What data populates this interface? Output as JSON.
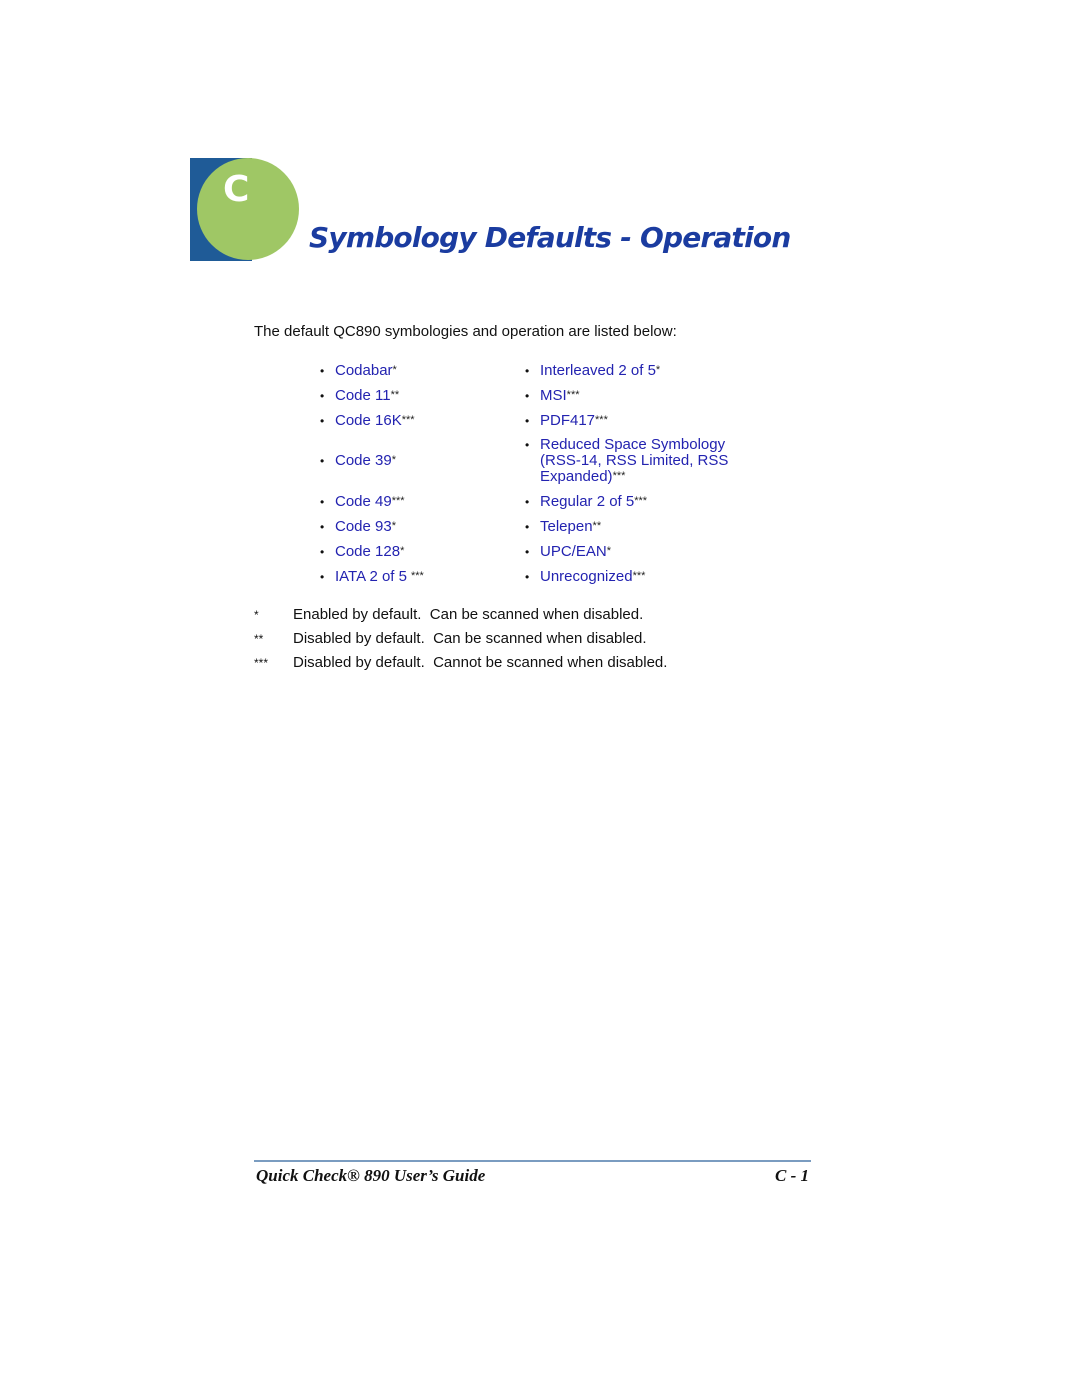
{
  "chapter": {
    "letter": "C",
    "title": "Symbology Defaults - Operation",
    "badge_colors": {
      "square": "#1f5b97",
      "circle": "#9fc765"
    }
  },
  "intro": "The default QC890 symbologies and operation are listed below:",
  "symbologies": {
    "bullet": "•",
    "rows": [
      {
        "left": {
          "label": "Codabar",
          "stars": "*"
        },
        "right": {
          "label": "Interleaved 2 of 5",
          "stars": "*"
        }
      },
      {
        "left": {
          "label": "Code 11",
          "stars": "**"
        },
        "right": {
          "label": "MSI",
          "stars": "***"
        }
      },
      {
        "left": {
          "label": "Code 16K",
          "stars": "***"
        },
        "right": {
          "label": "PDF417",
          "stars": "***"
        }
      },
      {
        "left": {
          "label": "Code 39",
          "stars": "*"
        },
        "right": {
          "label": "Reduced Space Symbology (RSS-14, RSS Limited, RSS Expanded)",
          "stars": "***"
        }
      },
      {
        "left": {
          "label": "Code 49",
          "stars": "***"
        },
        "right": {
          "label": "Regular 2 of 5",
          "stars": "***"
        }
      },
      {
        "left": {
          "label": "Code 93",
          "stars": "*"
        },
        "right": {
          "label": "Telepen",
          "stars": "**"
        }
      },
      {
        "left": {
          "label": "Code 128",
          "stars": "*"
        },
        "right": {
          "label": "UPC/EAN",
          "stars": "*"
        }
      },
      {
        "left": {
          "label": "IATA 2 of 5",
          "stars": "***"
        },
        "right": {
          "label": "Unrecognized",
          "stars": "***"
        }
      }
    ],
    "link_color": "#2323b0"
  },
  "legend": [
    {
      "key": "*",
      "text": "Enabled by default.  Can be scanned when disabled."
    },
    {
      "key": "**",
      "text": "Disabled by default.  Can be scanned when disabled."
    },
    {
      "key": "***",
      "text": "Disabled by default.  Cannot be scanned when disabled."
    }
  ],
  "footer": {
    "title": "Quick Check® 890 User’s Guide",
    "page": "C - 1"
  }
}
